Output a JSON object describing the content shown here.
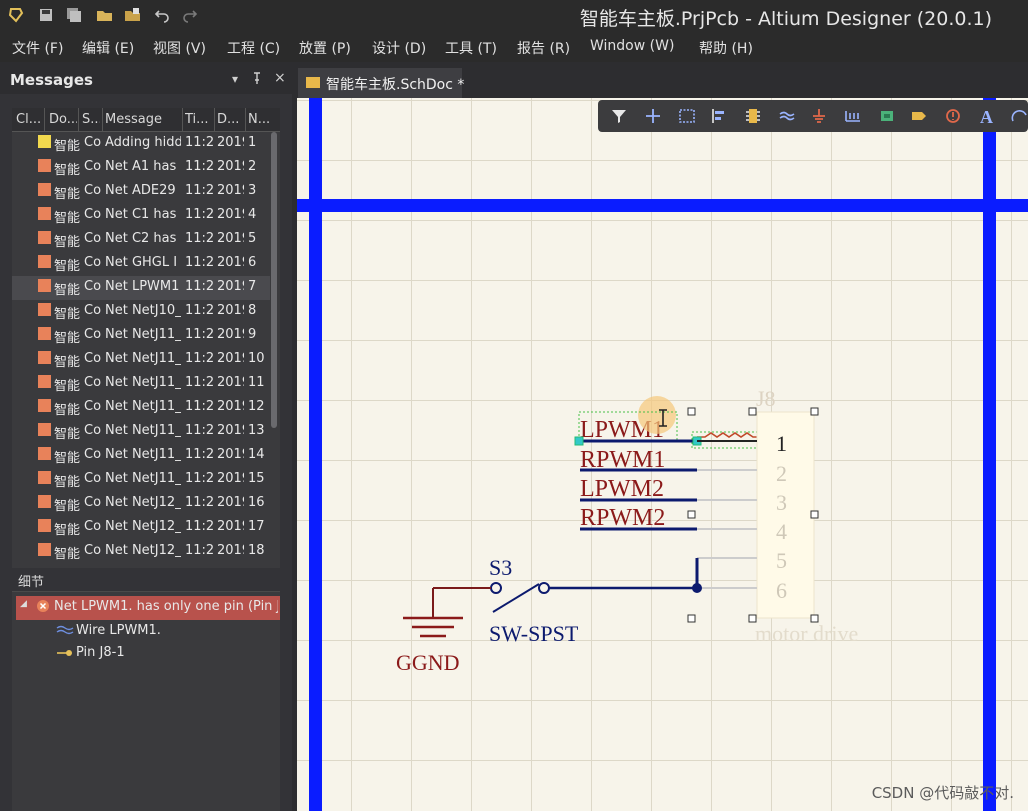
{
  "window": {
    "title": "智能车主板.PrjPcb - Altium Designer (20.0.1)"
  },
  "quick_access": [
    {
      "icon": "app-logo-icon"
    },
    {
      "icon": "save-icon"
    },
    {
      "icon": "save-all-icon"
    },
    {
      "icon": "open-folder-icon"
    },
    {
      "icon": "open-project-icon"
    },
    {
      "icon": "undo-icon"
    },
    {
      "icon": "redo-icon"
    }
  ],
  "menubar": {
    "items": [
      "文件 (F)",
      "编辑 (E)",
      "视图 (V)",
      "工程 (C)",
      "放置 (P)",
      "设计 (D)",
      "工具 (T)",
      "报告 (R)",
      "Window (W)",
      "帮助 (H)"
    ]
  },
  "messages_panel": {
    "title": "Messages",
    "controls": {
      "dropdown": "▾",
      "pin": "📌",
      "close": "×"
    },
    "columns": [
      "Cl...",
      "Do...",
      "S...",
      "Message",
      "Ti...",
      "D...",
      "N..."
    ],
    "rows": [
      {
        "doc": "智能",
        "src": "Co",
        "msg": "Adding hidd",
        "time": "11:2",
        "date": "2019",
        "no": "1",
        "level": "warning",
        "color": "#f2d94e"
      },
      {
        "doc": "智能",
        "src": "Co",
        "msg": "Net A1 has",
        "time": "11:2",
        "date": "2019",
        "no": "2",
        "level": "error",
        "color": "#e8825a"
      },
      {
        "doc": "智能",
        "src": "Co",
        "msg": "Net ADE29",
        "time": "11:2",
        "date": "2019",
        "no": "3",
        "level": "error",
        "color": "#e8825a"
      },
      {
        "doc": "智能",
        "src": "Co",
        "msg": "Net C1 has",
        "time": "11:2",
        "date": "2019",
        "no": "4",
        "level": "error",
        "color": "#e8825a"
      },
      {
        "doc": "智能",
        "src": "Co",
        "msg": "Net C2 has",
        "time": "11:2",
        "date": "2019",
        "no": "5",
        "level": "error",
        "color": "#e8825a"
      },
      {
        "doc": "智能",
        "src": "Co",
        "msg": "Net GHGL I",
        "time": "11:2",
        "date": "2019",
        "no": "6",
        "level": "error",
        "color": "#e8825a"
      },
      {
        "doc": "智能",
        "src": "Co",
        "msg": "Net LPWM1",
        "time": "11:2",
        "date": "2019",
        "no": "7",
        "level": "error",
        "color": "#e8825a",
        "selected": true
      },
      {
        "doc": "智能",
        "src": "Co",
        "msg": "Net NetJ10_",
        "time": "11:2",
        "date": "2019",
        "no": "8",
        "level": "error",
        "color": "#e8825a"
      },
      {
        "doc": "智能",
        "src": "Co",
        "msg": "Net NetJ11_",
        "time": "11:2",
        "date": "2019",
        "no": "9",
        "level": "error",
        "color": "#e8825a"
      },
      {
        "doc": "智能",
        "src": "Co",
        "msg": "Net NetJ11_",
        "time": "11:2",
        "date": "2019",
        "no": "10",
        "level": "error",
        "color": "#e8825a"
      },
      {
        "doc": "智能",
        "src": "Co",
        "msg": "Net NetJ11_",
        "time": "11:2",
        "date": "2019",
        "no": "11",
        "level": "error",
        "color": "#e8825a"
      },
      {
        "doc": "智能",
        "src": "Co",
        "msg": "Net NetJ11_",
        "time": "11:2",
        "date": "2019",
        "no": "12",
        "level": "error",
        "color": "#e8825a"
      },
      {
        "doc": "智能",
        "src": "Co",
        "msg": "Net NetJ11_",
        "time": "11:2",
        "date": "2019",
        "no": "13",
        "level": "error",
        "color": "#e8825a"
      },
      {
        "doc": "智能",
        "src": "Co",
        "msg": "Net NetJ11_",
        "time": "11:2",
        "date": "2019",
        "no": "14",
        "level": "error",
        "color": "#e8825a"
      },
      {
        "doc": "智能",
        "src": "Co",
        "msg": "Net NetJ11_",
        "time": "11:2",
        "date": "2019",
        "no": "15",
        "level": "error",
        "color": "#e8825a"
      },
      {
        "doc": "智能",
        "src": "Co",
        "msg": "Net NetJ12_",
        "time": "11:2",
        "date": "2019",
        "no": "16",
        "level": "error",
        "color": "#e8825a"
      },
      {
        "doc": "智能",
        "src": "Co",
        "msg": "Net NetJ12_",
        "time": "11:2",
        "date": "2019",
        "no": "17",
        "level": "error",
        "color": "#e8825a"
      },
      {
        "doc": "智能",
        "src": "Co",
        "msg": "Net NetJ12_",
        "time": "11:2",
        "date": "2019",
        "no": "18",
        "level": "error",
        "color": "#e8825a"
      }
    ]
  },
  "details": {
    "title": "细节",
    "items": [
      {
        "text": "Net LPWM1. has only one pin (Pin J8-1)",
        "icon": "error-circle-icon"
      },
      {
        "text": "Wire LPWM1.",
        "icon": "wire-icon"
      },
      {
        "text": "Pin J8-1",
        "icon": "pin-icon"
      }
    ]
  },
  "doc_tab": {
    "label": "智能车主板.SchDoc *"
  },
  "schematic": {
    "net_labels": [
      "LPWM1",
      "RPWM1",
      "LPWM2",
      "RPWM2"
    ],
    "connector": {
      "designator": "J8",
      "comment": "motor drive",
      "pins": [
        "1",
        "2",
        "3",
        "4",
        "5",
        "6"
      ]
    },
    "switch": {
      "designator": "S3",
      "comment": "SW-SPST"
    },
    "ground": {
      "net": "GGND"
    }
  },
  "watermark": "CSDN @代码敲不对.",
  "colors": {
    "border_blue": "#0a1cff",
    "label_red": "#8b1a1a",
    "wire_navy": "#0c1a6e",
    "canvas_bg": "#f7f4ea"
  }
}
